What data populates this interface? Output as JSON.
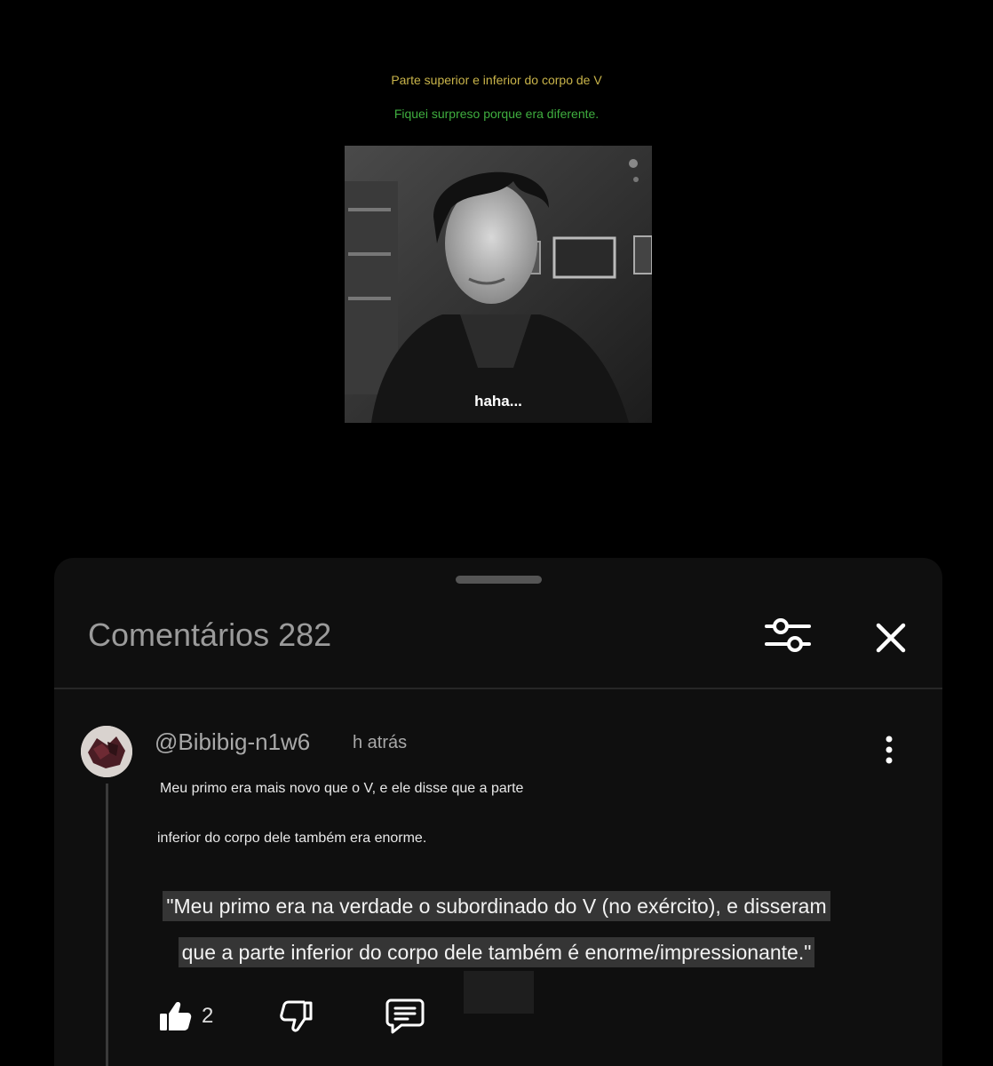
{
  "video": {
    "caption_top": "Parte superior e inferior do corpo de V",
    "caption_bottom": "Fiquei surpreso porque era diferente.",
    "subtitle": "haha..."
  },
  "comments_panel": {
    "title": "Comentários 282",
    "filter_icon": "sliders-icon",
    "close_icon": "close-icon"
  },
  "comment": {
    "author": "@Bibibig-n1w6",
    "timestamp": "h atrás",
    "text_line_1": "Meu primo era mais novo que o V, e ele disse que a parte",
    "text_line_2": "inferior do corpo dele também era enorme.",
    "translation_line_1": "\"Meu primo era na verdade o subordinado do V (no exército), e disseram",
    "translation_line_2": "que a parte inferior do corpo dele também é enorme/impressionante.\"",
    "likes": "2"
  },
  "colors": {
    "caption_top": "#c9b44a",
    "caption_bottom": "#3fae3f",
    "sheet_bg": "#0f0f0f"
  }
}
